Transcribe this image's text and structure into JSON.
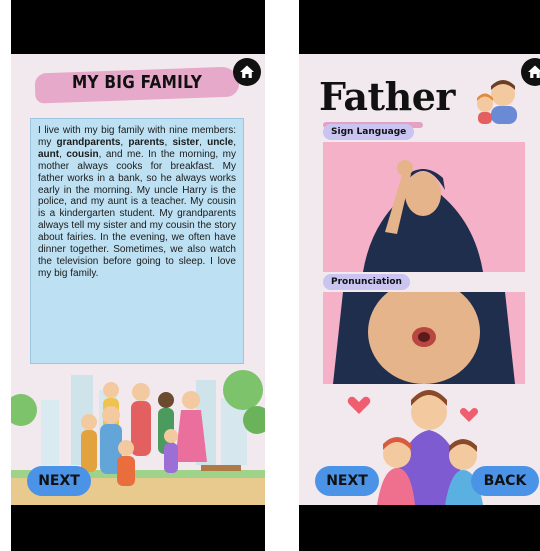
{
  "left_screen": {
    "title": "MY BIG FAMILY",
    "story": {
      "p1": "I live with my big family with nine members: my ",
      "b1": "grandparents",
      "s1": ", ",
      "b2": "parents",
      "s2": ", ",
      "b3": "sister",
      "s3": ", ",
      "b4": "uncle",
      "s4": ", ",
      "b5": "aunt",
      "s5": ", ",
      "b6": "cousin",
      "p2": ", and me. In the morning, my mother always cooks for breakfast. My father works in a bank, so he always works early in the morning. My uncle Harry is the police, and my aunt is a teacher. My cousin is a kindergarten student. My grandparents always tell my sister and my cousin the story about fairies. In the evening, we often have dinner together. Sometimes, we also watch the television before going to sleep. I love my big family."
    },
    "next_label": "NEXT",
    "home_icon": "home-icon"
  },
  "right_screen": {
    "word": "Father",
    "sign_language_label": "Sign Language",
    "pronunciation_label": "Pronunciation",
    "next_label": "NEXT",
    "back_label": "BACK",
    "home_icon": "home-icon"
  },
  "colors": {
    "background": "#f1e9ed",
    "title_brush": "#e6a9c9",
    "story_box": "#bde0f2",
    "button": "#4a93e6",
    "label_pill": "#c9c4f0",
    "photo_bg": "#f4b1c8",
    "hijab": "#1f2e4d"
  }
}
